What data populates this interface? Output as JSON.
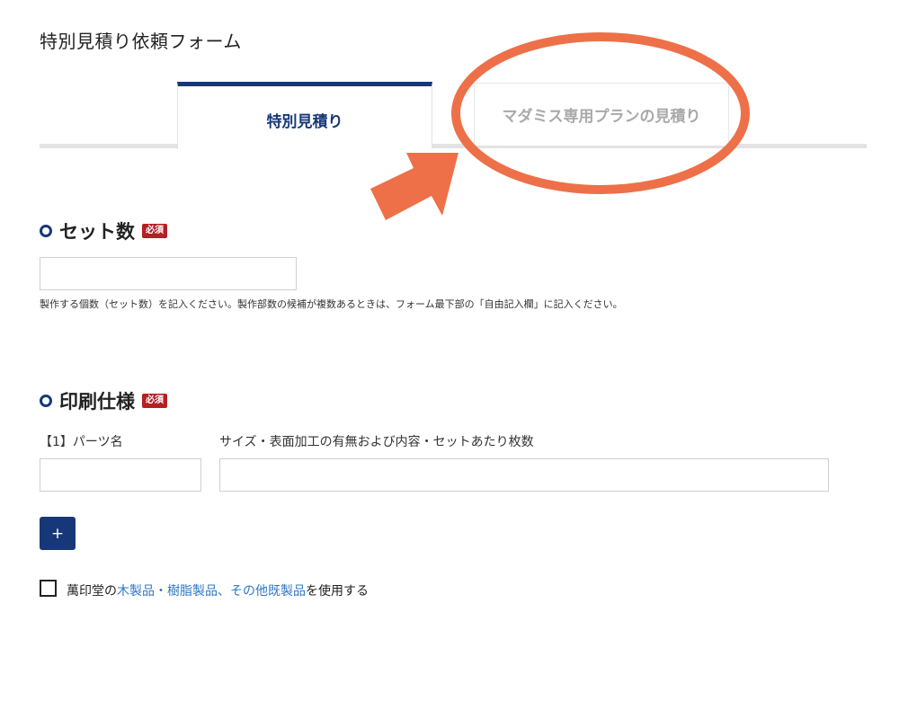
{
  "page": {
    "title": "特別見積り依頼フォーム"
  },
  "tabs": [
    {
      "label": "特別見積り",
      "active": true
    },
    {
      "label": "マダミス専用プランの見積り",
      "active": false
    }
  ],
  "annotation": {
    "circle_color": "#ee7048",
    "arrow_color": "#ee7048"
  },
  "sets_section": {
    "heading": "セット数",
    "required_badge": "必須",
    "input_value": "",
    "help": "製作する個数（セット数）を記入ください。製作部数の候補が複数あるときは、フォーム最下部の「自由記入欄」に記入ください。"
  },
  "print_section": {
    "heading": "印刷仕様",
    "required_badge": "必須",
    "part_label": "【1】パーツ名",
    "spec_label": "サイズ・表面加工の有無および内容・セットあたり枚数",
    "part_value": "",
    "spec_value": "",
    "add_button": "+"
  },
  "product_option": {
    "checked": false,
    "prefix": "萬印堂の",
    "link1": "木製品・樹脂製品",
    "separator": "、",
    "link2": "その他既製品",
    "suffix": "を使用する"
  },
  "colors": {
    "primary": "#173878",
    "required": "#b52026",
    "link": "#2f78c4"
  }
}
